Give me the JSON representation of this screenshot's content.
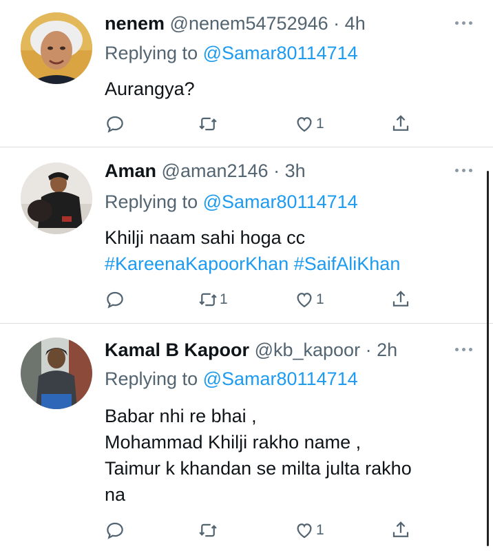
{
  "tweets": [
    {
      "name": "nenem",
      "handle": "@nenem54752946",
      "time": "4h",
      "replying_prefix": "Replying to",
      "replying_to": "@Samar80114714",
      "lines": [
        "Aurangya?"
      ],
      "retweets": "",
      "likes": "1",
      "avatar": "man-portrait-white-hair"
    },
    {
      "name": "Aman",
      "handle": "@aman2146",
      "time": "3h",
      "replying_prefix": "Replying to",
      "replying_to": "@Samar80114714",
      "lines": [
        "Khilji naam sahi hoga cc"
      ],
      "hashtags": [
        "#KareenaKapoorKhan",
        "#SaifAliKhan"
      ],
      "retweets": "1",
      "likes": "1",
      "avatar": "man-with-dog"
    },
    {
      "name": "Kamal B Kapoor",
      "handle": "@kb_kapoor",
      "time": "2h",
      "replying_prefix": "Replying to",
      "replying_to": "@Samar80114714",
      "lines": [
        "Babar nhi re bhai ,",
        "Mohammad Khilji rakho name ,",
        "Taimur k khandan se milta julta rakho",
        "na"
      ],
      "retweets": "",
      "likes": "1",
      "avatar": "man-in-hoodie"
    }
  ],
  "separator": "·",
  "icons": {
    "reply": "reply-icon",
    "retweet": "retweet-icon",
    "like": "like-icon",
    "share": "share-icon",
    "more": "more-icon"
  },
  "colors": {
    "link": "#1d9bf0",
    "secondary": "#536471",
    "text": "#0f1419",
    "divider": "#d9dde0"
  }
}
